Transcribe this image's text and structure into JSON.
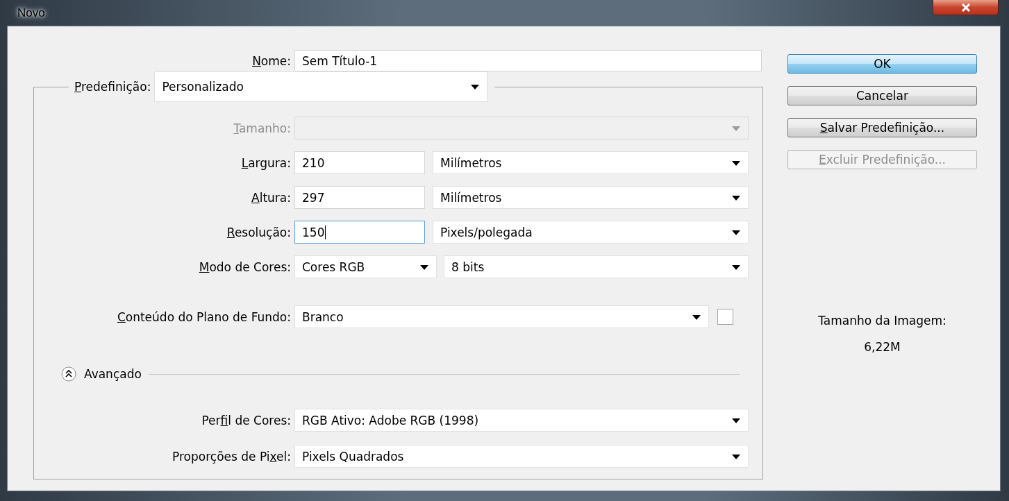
{
  "window": {
    "title": "Novo"
  },
  "name_field": {
    "label": "Nome:",
    "value": "Sem Título-1"
  },
  "preset": {
    "label": "Predefinição:",
    "value": "Personalizado"
  },
  "rows": [
    {
      "kind": "select",
      "label": "Tamanho:",
      "disabled": true
    },
    {
      "kind": "dimension",
      "label": "Largura:",
      "value": "210",
      "unit": "Milímetros",
      "focused": false
    },
    {
      "kind": "dimension",
      "label": "Altura:",
      "value": "297",
      "unit": "Milímetros",
      "focused": false
    },
    {
      "kind": "dimension",
      "label": "Resolução:",
      "value": "150",
      "unit": "Pixels/polegada",
      "focused": true
    },
    {
      "kind": "pair",
      "label": "Modo de Cores:",
      "value": "Cores RGB",
      "unit": "8 bits"
    },
    {
      "kind": "background",
      "label": "Conteúdo do Plano de Fundo:",
      "value": "Branco",
      "color": "#ffffff"
    }
  ],
  "advanced": {
    "label": "Avançado",
    "expanded": true
  },
  "advanced_rows": [
    {
      "label": "Perfil de Cores:",
      "value": "RGB Ativo:  Adobe RGB (1998)"
    },
    {
      "label": "Proporções de Pixel:",
      "value": "Pixels Quadrados"
    }
  ],
  "buttons": [
    {
      "label": "OK",
      "default": true,
      "disabled": false
    },
    {
      "label": "Cancelar",
      "default": false,
      "disabled": false
    },
    {
      "label": "Salvar Predefinição...",
      "default": false,
      "disabled": false
    },
    {
      "label": "Excluir Predefinição...",
      "default": false,
      "disabled": true
    }
  ],
  "image_size": {
    "label": "Tamanho da Imagem:",
    "value": "6,22M"
  }
}
